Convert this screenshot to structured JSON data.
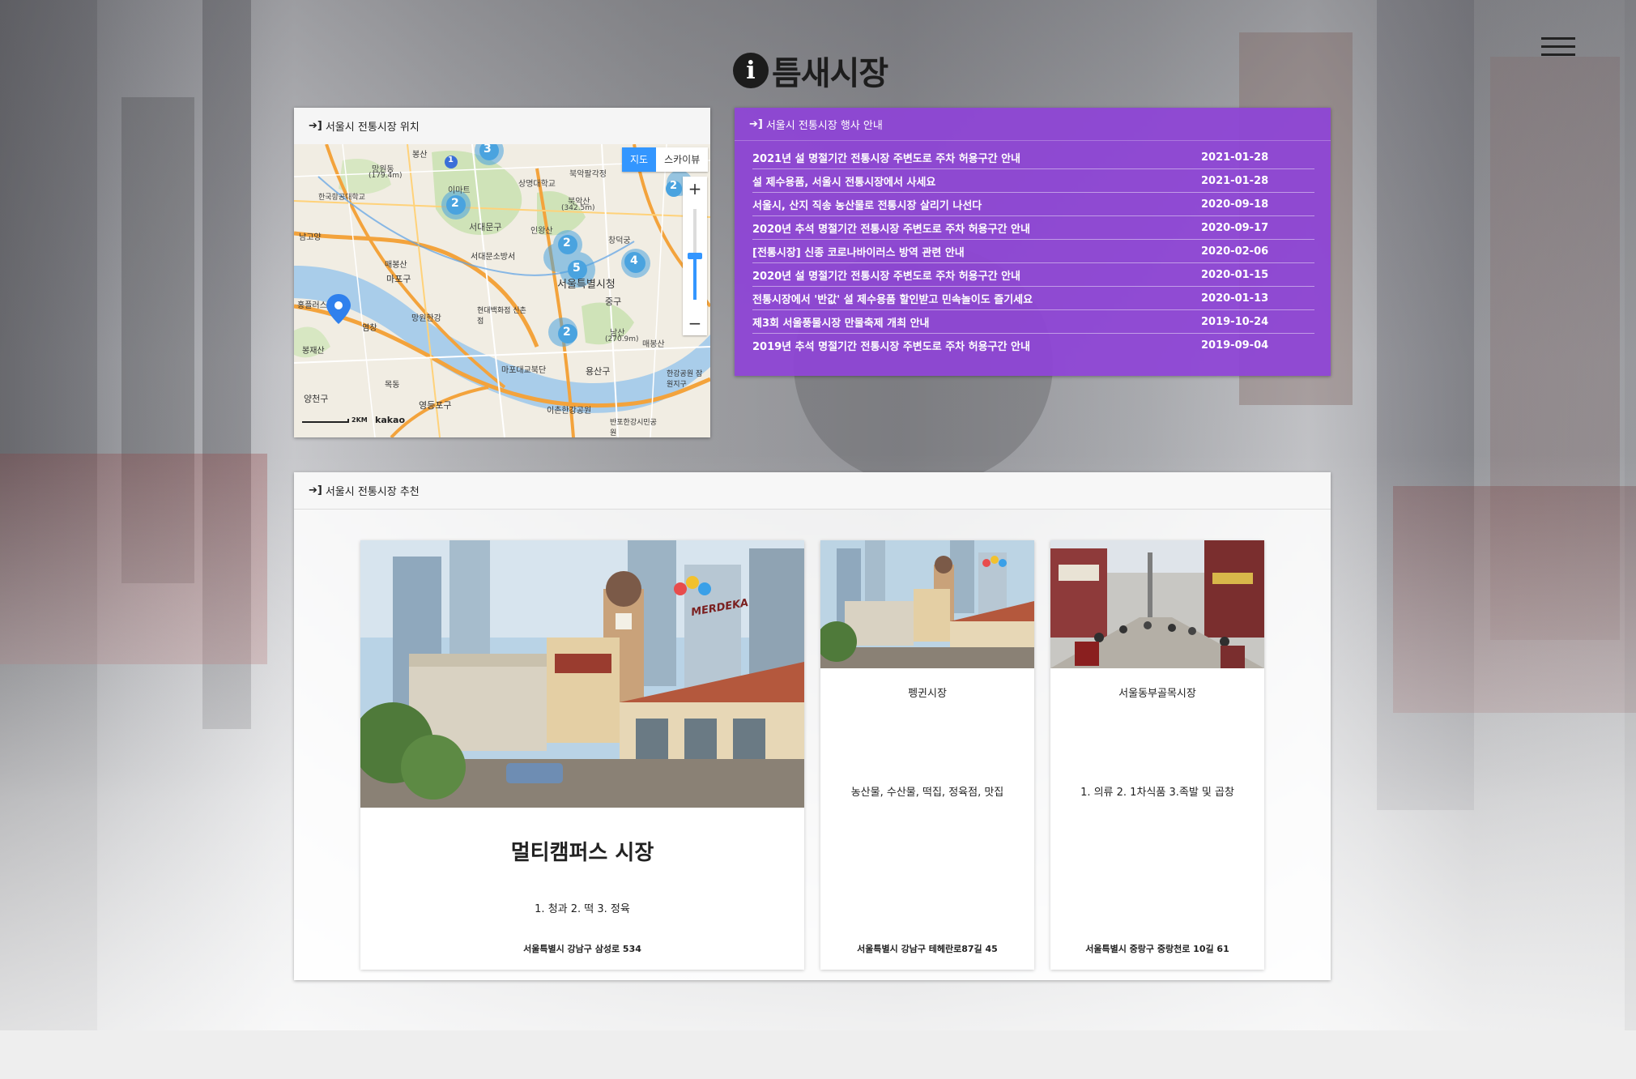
{
  "header": {
    "title": "틈새시장",
    "menu_icon": "hamburger-menu-icon",
    "info_icon": "info-icon"
  },
  "map_panel": {
    "heading": "서울시 전통시장 위치",
    "toggle_map": "지도",
    "toggle_sky": "스카이뷰",
    "zoom_in": "+",
    "zoom_out": "−",
    "scale_label": "2KM",
    "provider": "kakao",
    "labels": {
      "mangwon": "망원동",
      "mangwon_h": "(179.4m)",
      "univ": "한국항공대학교",
      "emart": "이마트",
      "sangmyung": "상명대학교",
      "bukak": "북악산",
      "bukak_h": "(342.5m)",
      "bukak_palgak": "북악팔각정",
      "seodaemun": "서대문구",
      "inwang": "인왕산",
      "changdeok": "창덕궁",
      "mapo": "마포구",
      "seodaemun_sta": "서대문소방서",
      "cityhall": "서울특별시청",
      "junggu": "중구",
      "hyundai": "현대백화점 신촌점",
      "mangwon_hangang": "망원한강",
      "namsan": "남산",
      "namsan_h": "(270.9m)",
      "maebong": "매봉산",
      "yongsan": "용산구",
      "mapo_bridge": "마포대교북단",
      "yangcheon": "양천구",
      "yeongdeungpo": "영등포구",
      "ichon": "이촌한강공원",
      "banpo": "반포한강시민공원",
      "hangang_jamwon": "한강공원 잠원지구",
      "bongjae": "봉재산",
      "hongpa": "홍플러스",
      "namgok": "남고양",
      "bongdaesan": "봉산",
      "mokdong": "목동",
      "yeompo": "염창",
      "maesangbong": "매봉산"
    },
    "clusters": [
      "3",
      "1",
      "2",
      "5",
      "2",
      "4",
      "2",
      "2"
    ]
  },
  "news_panel": {
    "heading": "서울시 전통시장 행사 안내",
    "items": [
      {
        "title": "2021년 설 명절기간 전통시장 주변도로 주차 허용구간 안내",
        "date": "2021-01-28"
      },
      {
        "title": "설 제수용품, 서울시 전통시장에서 사세요",
        "date": "2021-01-28"
      },
      {
        "title": "서울시, 산지 직송 농산물로 전통시장 살리기 나선다",
        "date": "2020-09-18"
      },
      {
        "title": "2020년 추석 명절기간 전통시장 주변도로 주차 허용구간 안내",
        "date": "2020-09-17"
      },
      {
        "title": "[전통시장] 신종 코로나바이러스 방역 관련 안내",
        "date": "2020-02-06"
      },
      {
        "title": "2020년 설 명절기간 전통시장 주변도로 주차 허용구간 안내",
        "date": "2020-01-15"
      },
      {
        "title": "전통시장에서 '반값' 설 제수용품 할인받고 민속놀이도 즐기세요",
        "date": "2020-01-13"
      },
      {
        "title": "제3회 서울풍물시장 만물축제 개최 안내",
        "date": "2019-10-24"
      },
      {
        "title": "2019년 추석 명절기간 전통시장 주변도로 주차 허용구간 안내",
        "date": "2019-09-04"
      }
    ]
  },
  "rec_panel": {
    "heading": "서울시 전통시장 추천",
    "cards": [
      {
        "name": "멀티캠퍼스 시장",
        "items": "1. 청과 2. 떡 3. 정육",
        "address": "서울특별시 강남구 삼성로 534",
        "sign": "MERDEKA"
      },
      {
        "name": "펭귄시장",
        "items": "농산물, 수산물, 떡집, 정육점, 맛집",
        "address": "서울특별시 강남구 테헤란로87길 45"
      },
      {
        "name": "서울동부골목시장",
        "items": "1. 의류 2. 1차식품 3.족발 및 곱창",
        "address": "서울특별시 중랑구 중랑천로 10길 61"
      }
    ]
  },
  "colors": {
    "news_bg": "#8e44d6",
    "map_button_active": "#3396ff",
    "cluster": "#4aa3df"
  }
}
